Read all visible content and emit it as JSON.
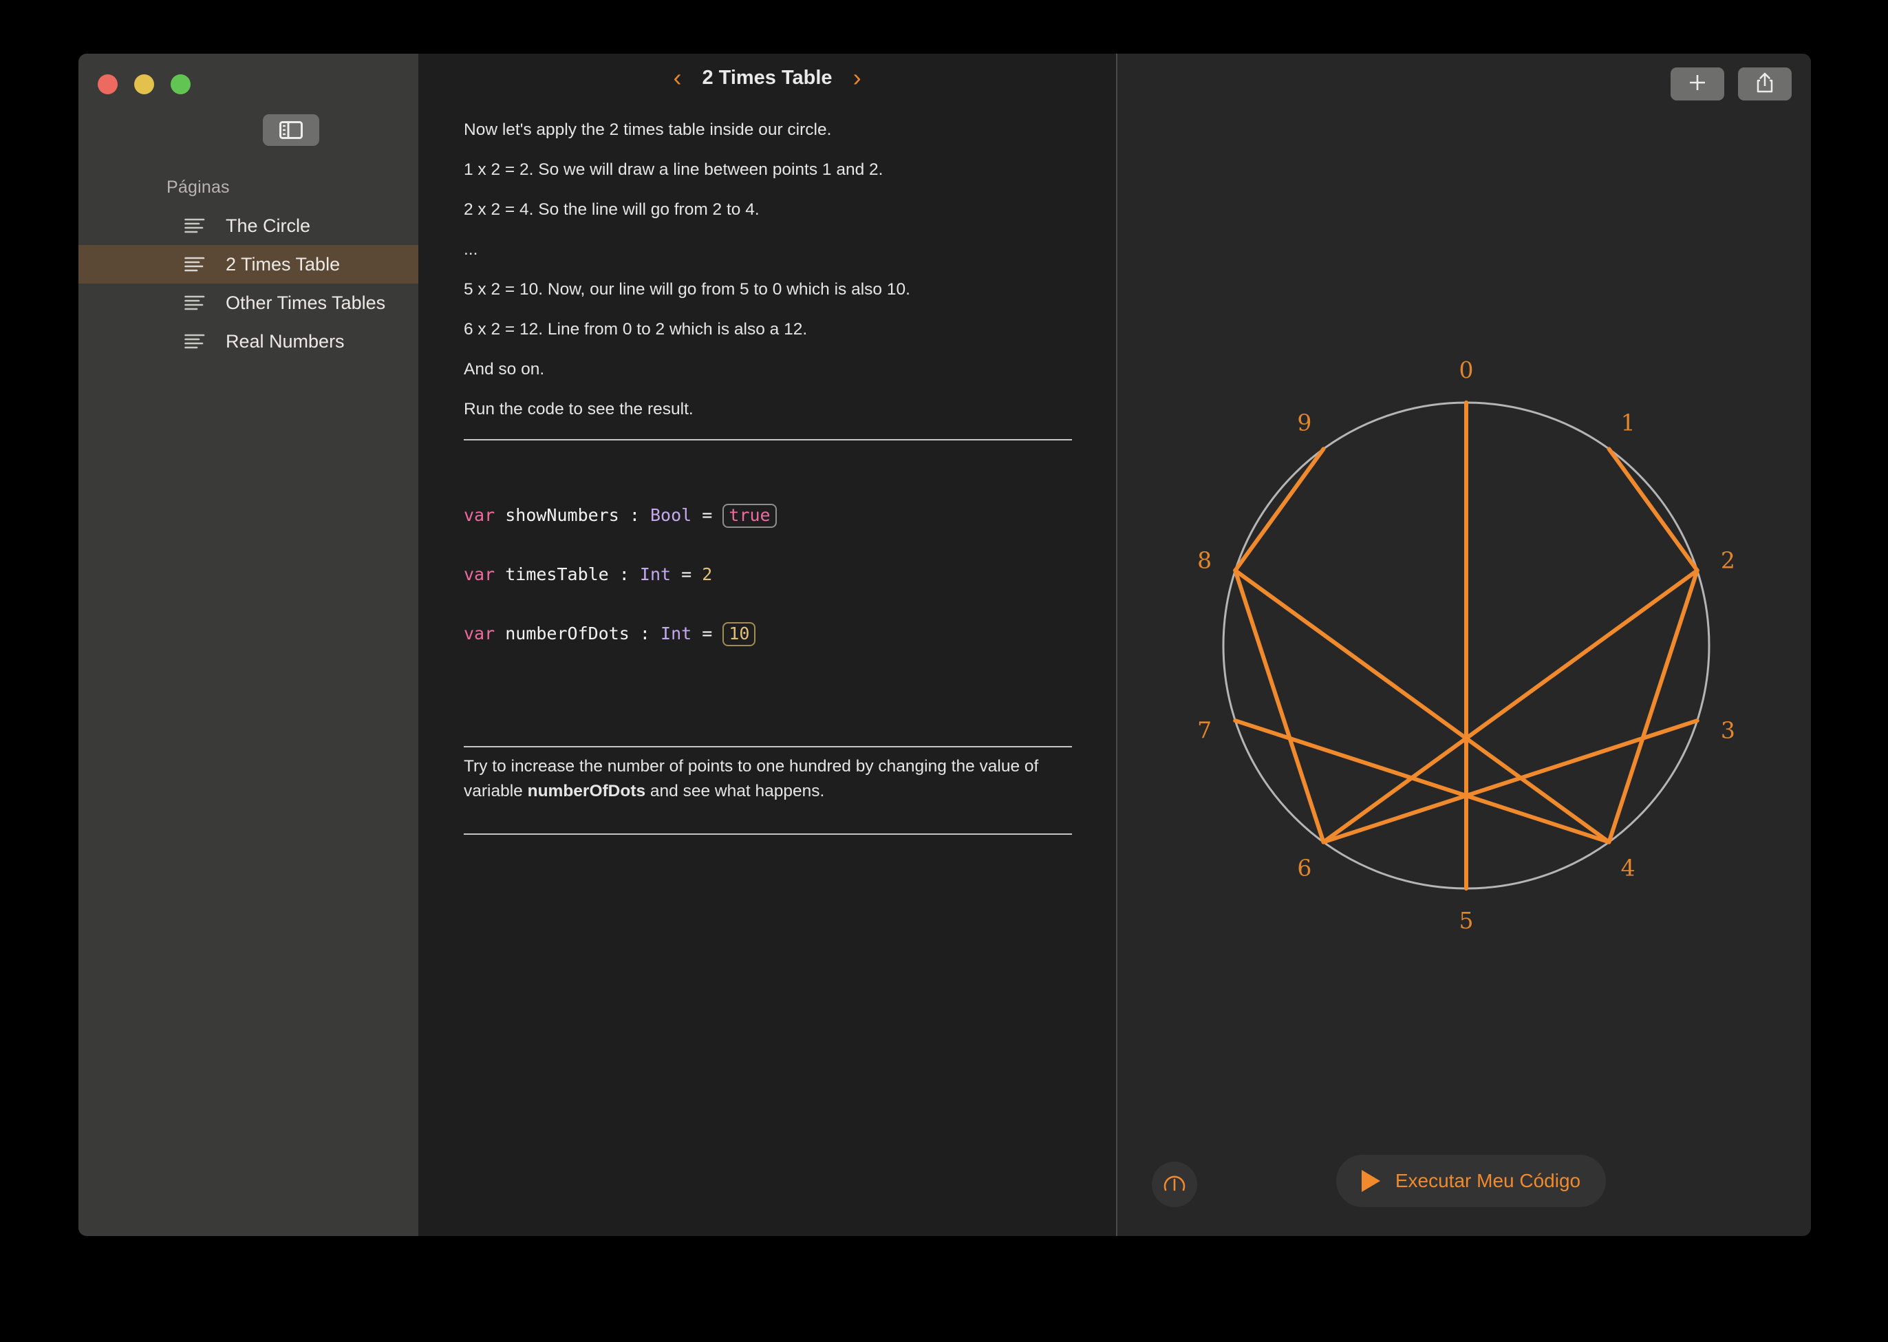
{
  "window": {
    "traffic_lights": [
      {
        "name": "close",
        "color": "#ec6a5f"
      },
      {
        "name": "minimize",
        "color": "#e3c14c"
      },
      {
        "name": "zoom",
        "color": "#62c452"
      }
    ]
  },
  "sidebar": {
    "toggle_icon": "sidebar-toggle-icon",
    "section_label": "Páginas",
    "items": [
      {
        "label": "The Circle",
        "icon": "text-lines-icon",
        "selected": false
      },
      {
        "label": "2 Times Table",
        "icon": "text-lines-icon",
        "selected": true
      },
      {
        "label": "Other Times Tables",
        "icon": "text-lines-icon",
        "selected": false
      },
      {
        "label": "Real Numbers",
        "icon": "text-lines-icon",
        "selected": false
      }
    ],
    "selected_color": "#5b4936"
  },
  "content": {
    "prev_icon": "‹",
    "next_icon": "›",
    "title": "2 Times Table",
    "paragraphs": [
      "Now let's apply the 2 times table inside our circle.",
      "1 x 2 = 2. So we will draw a line between points 1 and 2.",
      "2 x 2 = 4. So the line will go from 2 to 4.",
      "...",
      "5 x 2 = 10. Now, our line will go from 5 to 0 which is also 10.",
      "6 x 2 = 12. Line from 0 to 2 which is also a 12.",
      "And so on.",
      "Run the code to see the result."
    ],
    "code": {
      "line1": {
        "kw": "var",
        "id": "showNumbers",
        "colon": ":",
        "type": "Bool",
        "eq": "=",
        "value": "true"
      },
      "line2": {
        "kw": "var",
        "id": "timesTable",
        "colon": ":",
        "type": "Int",
        "eq": "=",
        "value": "2"
      },
      "line3": {
        "kw": "var",
        "id": "numberOfDots",
        "colon": ":",
        "type": "Int",
        "eq": "=",
        "value": "10"
      }
    },
    "hint": {
      "before": "Try to increase the number of points to one hundred by changing the value of variable ",
      "bold": "numberOfDots",
      "after": " and see what happens."
    }
  },
  "liveview": {
    "add_button_icon": "plus-icon",
    "share_button_icon": "share-icon",
    "speed_button_icon": "speedometer-icon",
    "run_button_label": "Executar Meu Código",
    "run_button_icon": "play-icon",
    "accent_color": "#f08a2c",
    "circle_color": "#b5b5b5"
  },
  "chart_data": {
    "type": "scatter",
    "title": "2 Times Table Modular Circle",
    "times_table": 2,
    "number_of_dots": 10,
    "show_numbers": true,
    "point_labels": [
      "0",
      "1",
      "2",
      "3",
      "4",
      "5",
      "6",
      "7",
      "8",
      "9"
    ],
    "center": [
      2131,
      938
    ],
    "radius": 353,
    "label_radius": 400,
    "point_angles_deg": [
      0,
      36,
      72,
      108,
      144,
      180,
      216,
      252,
      288,
      324
    ],
    "chords": [
      {
        "from": 0,
        "to": 0
      },
      {
        "from": 1,
        "to": 2
      },
      {
        "from": 2,
        "to": 4
      },
      {
        "from": 3,
        "to": 6
      },
      {
        "from": 4,
        "to": 8
      },
      {
        "from": 5,
        "to": 0
      },
      {
        "from": 6,
        "to": 2
      },
      {
        "from": 7,
        "to": 4
      },
      {
        "from": 8,
        "to": 6
      },
      {
        "from": 9,
        "to": 8
      }
    ],
    "line_color": "#f08a2c",
    "circle_stroke": "#b5b5b5",
    "label_color": "#e0872e",
    "background": "#272727"
  }
}
